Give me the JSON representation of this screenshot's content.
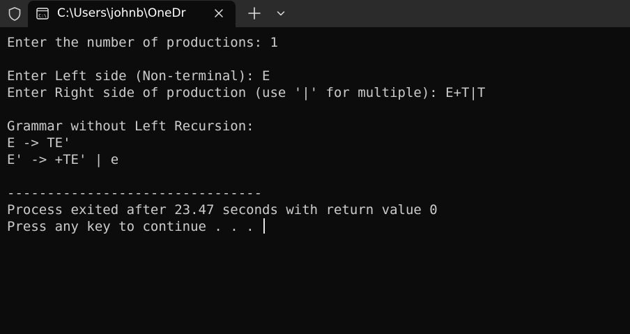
{
  "tab": {
    "title": "C:\\Users\\johnb\\OneDr",
    "icon": "terminal-icon"
  },
  "titlebar": {
    "shield_icon": "shield-icon",
    "close_icon": "close-icon",
    "new_tab_icon": "plus-icon",
    "dropdown_icon": "chevron-down-icon"
  },
  "terminal": {
    "lines": [
      "Enter the number of productions: 1",
      "",
      "Enter Left side (Non-terminal): E",
      "Enter Right side of production (use '|' for multiple): E+T|T",
      "",
      "Grammar without Left Recursion:",
      "E -> TE'",
      "E' -> +TE' | e",
      "",
      "--------------------------------",
      "Process exited after 23.47 seconds with return value 0",
      "Press any key to continue . . . "
    ]
  },
  "colors": {
    "background": "#0c0c0c",
    "titlebar": "#2b2b2b",
    "text": "#cccccc"
  }
}
